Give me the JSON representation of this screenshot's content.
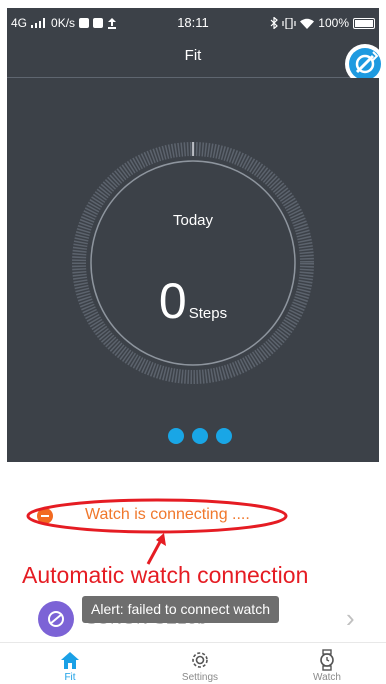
{
  "status_bar": {
    "network": "4G",
    "speed": "0K/s",
    "time": "18:11",
    "battery": "100%"
  },
  "header": {
    "title": "Fit"
  },
  "dashboard": {
    "today_label": "Today",
    "steps_count": "0",
    "steps_unit": "Steps",
    "page_count": 3,
    "active_page": 0
  },
  "connection": {
    "status_text": "Watch is connecting ...."
  },
  "annotation": {
    "text": "Automatic watch connection"
  },
  "device": {
    "name": "SUNON SE2ob"
  },
  "toast": {
    "message": "Alert: failed to connect watch"
  },
  "nav": {
    "items": [
      {
        "label": "Fit",
        "icon": "home-icon",
        "active": true
      },
      {
        "label": "Settings",
        "icon": "gear-icon",
        "active": false
      },
      {
        "label": "Watch",
        "icon": "watch-icon",
        "active": false
      }
    ]
  },
  "colors": {
    "dark_panel": "#3c4148",
    "accent": "#1aa0e6",
    "warning": "#f0782c",
    "annotation_red": "#e51c23",
    "device_purple": "#7c63d6"
  }
}
